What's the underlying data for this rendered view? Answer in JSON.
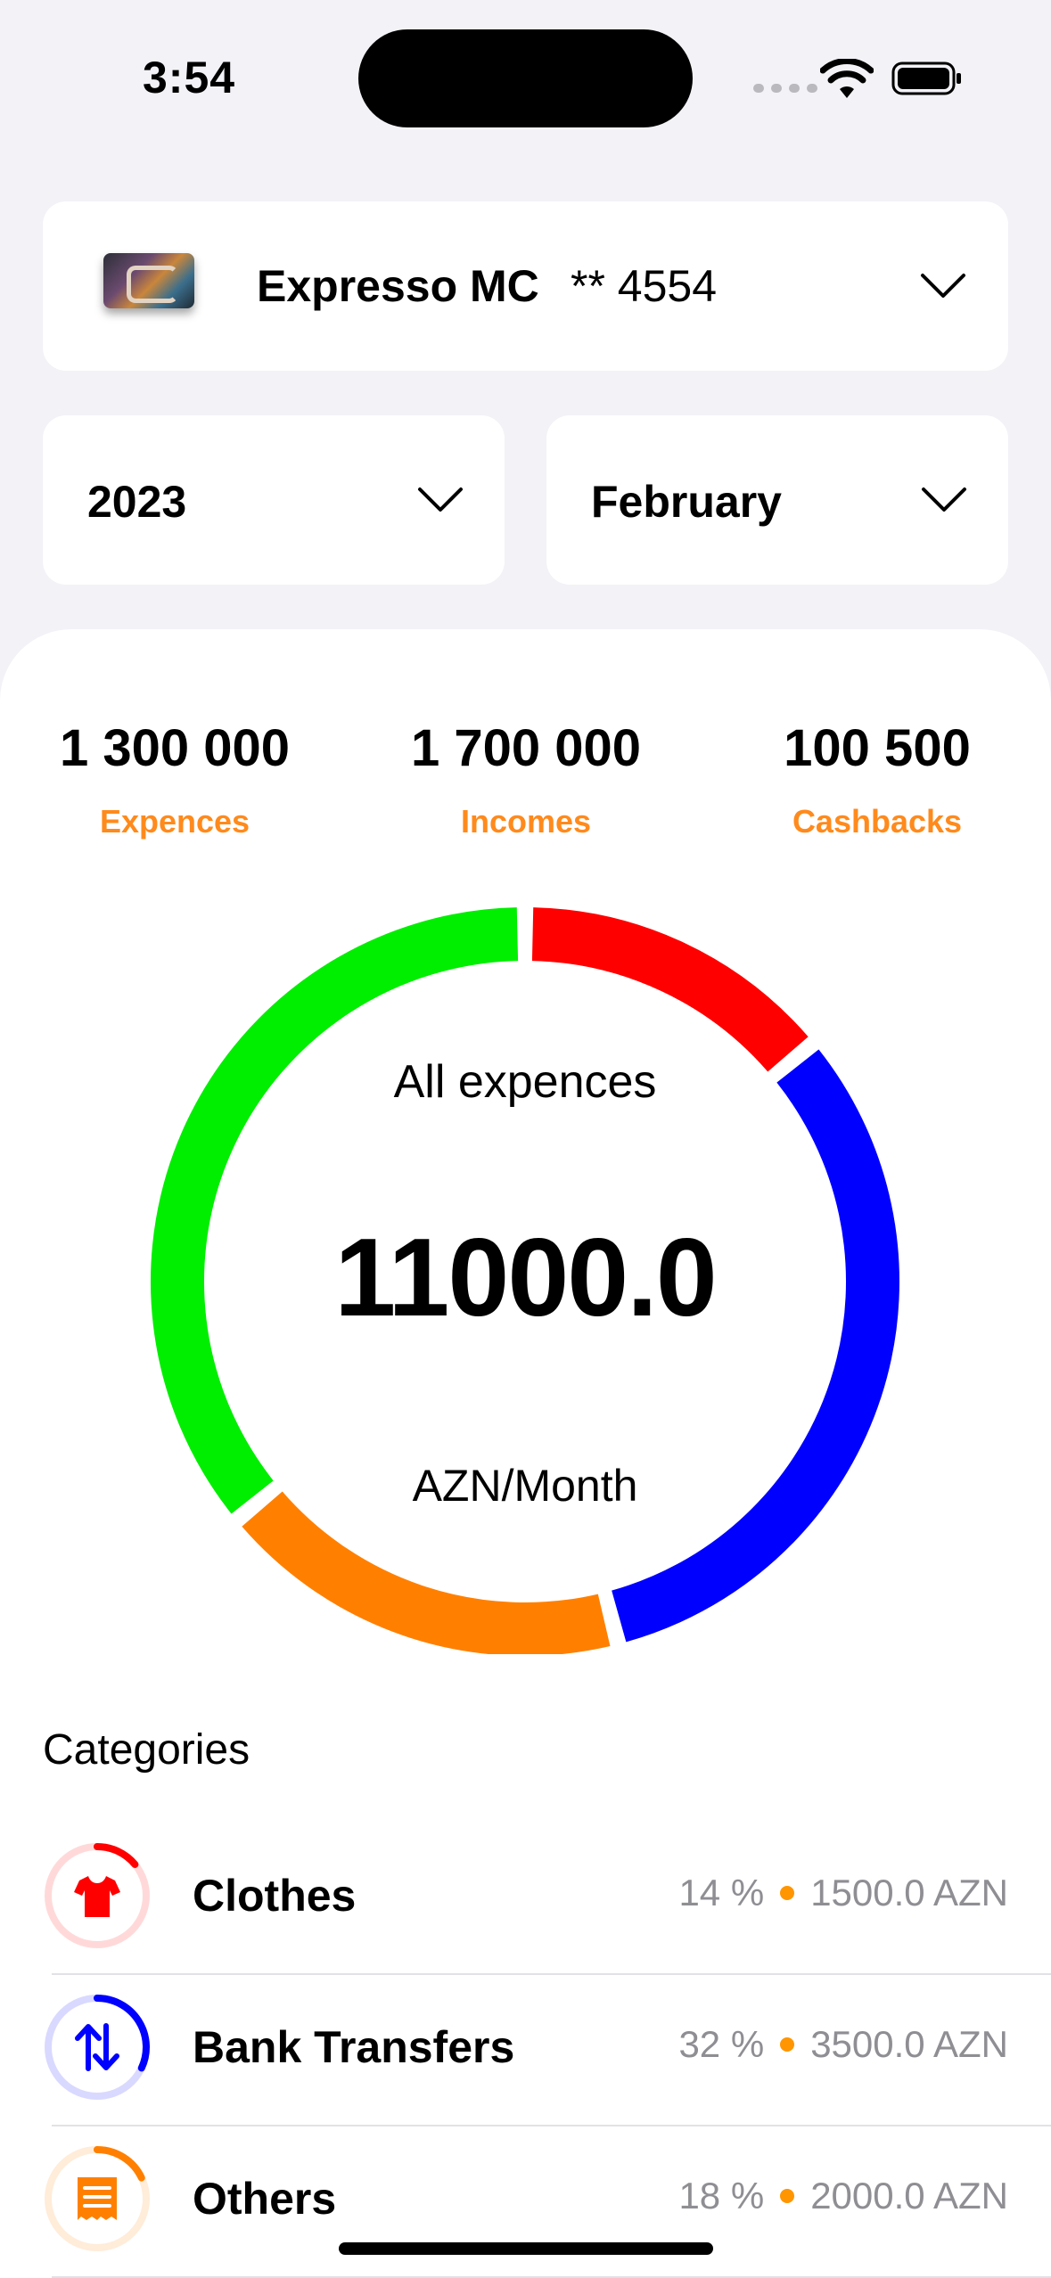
{
  "status_bar": {
    "time": "3:54"
  },
  "card_selector": {
    "name": "Expresso MC",
    "number": "** 4554"
  },
  "year_selector": {
    "value": "2023"
  },
  "month_selector": {
    "value": "February"
  },
  "stats": [
    {
      "value": "1 300 000",
      "label": "Expences"
    },
    {
      "value": "1 700 000",
      "label": "Incomes"
    },
    {
      "value": "100 500",
      "label": "Cashbacks"
    }
  ],
  "chart_data": {
    "type": "pie",
    "title": "All expences",
    "total": "11000.0",
    "unit": "AZN/Month",
    "segments": [
      {
        "color": "#ff0000",
        "fraction": 0.14
      },
      {
        "color": "#0000ff",
        "fraction": 0.32
      },
      {
        "color": "#ff8000",
        "fraction": 0.18
      },
      {
        "color": "#00ee00",
        "fraction": 0.36
      }
    ]
  },
  "categories": {
    "heading": "Categories",
    "items": [
      {
        "name": "Clothes",
        "percent": "14 %",
        "amount": "1500.0 AZN",
        "color": "#ff0000",
        "fraction": 0.14,
        "icon": "tshirt-icon"
      },
      {
        "name": "Bank Transfers",
        "percent": "32 %",
        "amount": "3500.0 AZN",
        "color": "#0000ff",
        "fraction": 0.32,
        "icon": "transfer-arrows-icon"
      },
      {
        "name": "Others",
        "percent": "18 %",
        "amount": "2000.0 AZN",
        "color": "#ff8000",
        "fraction": 0.18,
        "icon": "receipt-icon"
      }
    ]
  }
}
